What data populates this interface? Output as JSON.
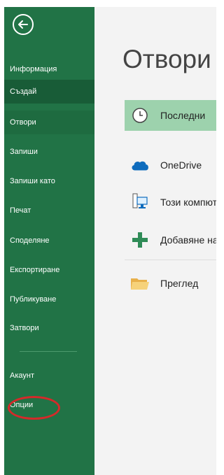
{
  "sidebar": {
    "items": [
      {
        "label": "Информация"
      },
      {
        "label": "Създай"
      },
      {
        "label": "Отвори"
      },
      {
        "label": "Запиши"
      },
      {
        "label": "Запиши като"
      },
      {
        "label": "Печат"
      },
      {
        "label": "Споделяне"
      },
      {
        "label": "Експортиране"
      },
      {
        "label": "Публикуване"
      },
      {
        "label": "Затвори"
      }
    ],
    "footer_items": [
      {
        "label": "Акаунт"
      },
      {
        "label": "Опции"
      }
    ]
  },
  "main": {
    "title": "Отвори",
    "locations": [
      {
        "label": "Последни",
        "icon": "clock-icon"
      },
      {
        "label": "OneDrive",
        "icon": "cloud-icon"
      },
      {
        "label": "Този компютър",
        "icon": "computer-icon"
      },
      {
        "label": "Добавяне на място",
        "icon": "plus-icon"
      },
      {
        "label": "Преглед",
        "icon": "folder-icon"
      }
    ]
  },
  "colors": {
    "sidebar": "#217346",
    "sidebar_active": "#185c37",
    "selected_location": "#9dd2ad",
    "annotation": "#d42a2a"
  }
}
